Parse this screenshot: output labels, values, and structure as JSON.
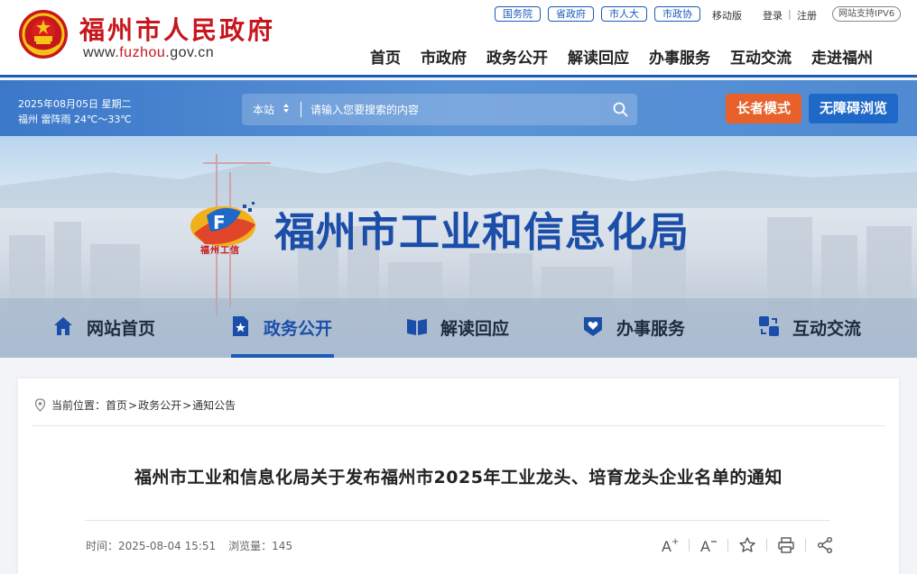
{
  "header": {
    "site_title": "福州市人民政府",
    "url_prefix": "www.",
    "url_mid": "fuzhou",
    "url_suffix": ".gov.cn",
    "quick_links": [
      "国务院",
      "省政府",
      "市人大",
      "市政协"
    ],
    "mobile_label": "移动版",
    "login_label": "登录",
    "register_label": "注册",
    "ipv6_label": "网站支持IPV6",
    "nav": [
      "首页",
      "市政府",
      "政务公开",
      "解读回应",
      "办事服务",
      "互动交流",
      "走进福州"
    ]
  },
  "band": {
    "date_line": "2025年08月05日 星期二",
    "weather_line": "福州 雷阵雨 24℃～33℃",
    "search_scope": "本站",
    "search_placeholder": "请输入您要搜索的内容",
    "elder_mode_label": "长者模式",
    "accessible_label": "无障碍浏览"
  },
  "banner": {
    "logo_text": "福州工信",
    "site_name": "福州市工业和信息化局",
    "sub_nav": [
      {
        "label": "网站首页",
        "icon": "home-icon"
      },
      {
        "label": "政务公开",
        "icon": "document-star-icon",
        "active": true
      },
      {
        "label": "解读回应",
        "icon": "book-icon"
      },
      {
        "label": "办事服务",
        "icon": "heart-shield-icon"
      },
      {
        "label": "互动交流",
        "icon": "chat-exchange-icon"
      }
    ]
  },
  "article": {
    "breadcrumb_label": "当前位置：",
    "breadcrumb": [
      "首页",
      "政务公开",
      "通知公告"
    ],
    "title": "福州市工业和信息化局关于发布福州市2025年工业龙头、培育龙头企业名单的通知",
    "time_label": "时间：",
    "time_value": "2025-08-04 15:51",
    "views_label": "浏览量：",
    "views_value": "145"
  },
  "colors": {
    "brand_red": "#c8161d",
    "primary_blue": "#1b5bb8",
    "elder_orange": "#e8612a"
  }
}
